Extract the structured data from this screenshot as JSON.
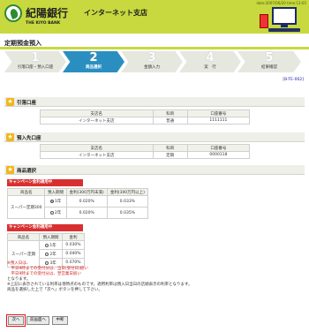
{
  "header": {
    "datetime": "date:2007/06/20 time:13:05",
    "bank_name": "紀陽銀行",
    "branch_name": "インターネット支店",
    "bank_en": "THE KIYO BANK"
  },
  "page": {
    "title": "定期預金預入",
    "screen_id": "[B-TE-002]"
  },
  "steps": [
    {
      "num": "1",
      "label": "引落口座・預入口座"
    },
    {
      "num": "2",
      "label": "商品選択"
    },
    {
      "num": "3",
      "label": "金額入力"
    },
    {
      "num": "4",
      "label": "実　行"
    },
    {
      "num": "5",
      "label": "結果確認"
    }
  ],
  "debit_section": {
    "title": "引落口座",
    "headers": [
      "支店名",
      "科目",
      "口座番号"
    ],
    "row": [
      "インターネット支店",
      "普通",
      "1111111"
    ]
  },
  "deposit_section": {
    "title": "預入先口座",
    "headers": [
      "支店名",
      "科目",
      "口座番号"
    ],
    "row": [
      "インターネット支店",
      "定期",
      "0000118"
    ]
  },
  "product_section": {
    "title": "商品選択",
    "campaign_label": "キャンペーン金利適用中",
    "table1": {
      "headers": [
        "商品名",
        "預入期間",
        "金利(300万円未満)",
        "金利(300万円以上)"
      ],
      "product": "スーパー定期300",
      "rows": [
        {
          "period": "1年",
          "rate1": "0.020%",
          "rate2": "0.033%",
          "selected": true
        },
        {
          "period": "2年",
          "rate1": "0.020%",
          "rate2": "0.035%",
          "selected": false
        }
      ]
    },
    "table2": {
      "headers": [
        "商品名",
        "預入期間",
        "金利"
      ],
      "product": "スーパー定期",
      "rows": [
        {
          "period": "1年",
          "rate": "0.030%"
        },
        {
          "period": "2年",
          "rate": "0.040%"
        },
        {
          "period": "3年",
          "rate": "0.070%"
        }
      ]
    }
  },
  "notes": {
    "line1": "※預入日は、",
    "line2": "　平日9時までの受付分は、当日(受付日)扱い",
    "line3": "　平日9時までの受付分は、翌営業日扱い",
    "line4": "となります。",
    "line5": "※上記に表示されている利率は現時点のものです。適用利率は預入日当日の店頭表示の利率となります。",
    "line6": "商品を選択した上で「次へ」ボタンを押して下さい。"
  },
  "buttons": {
    "next": "次へ",
    "back": "前画面へ",
    "cancel": "中断"
  }
}
